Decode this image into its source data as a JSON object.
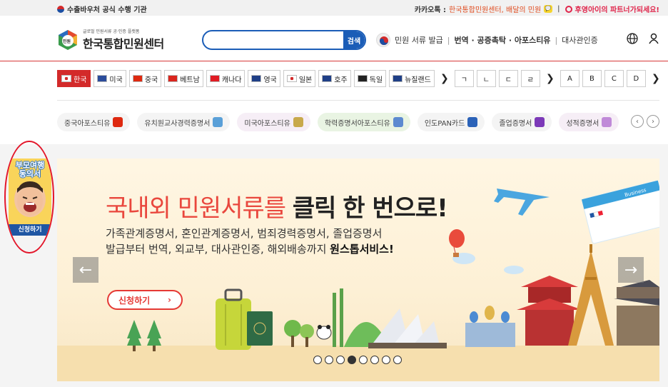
{
  "topbar": {
    "left_text": "수출바우처 공식 수행 기관",
    "kakao_label": "카카오톡 :",
    "kakao_text": "한국통합민원센터, 배달의 민원",
    "partner_text": "후영아이의 파트너가되세요!"
  },
  "header": {
    "logo_sub": "글로벌 민원서류 공·인증 플랫폼",
    "logo_main": "한국통합민원센터",
    "logo_badge": "민원",
    "search_placeholder": "",
    "search_button": "검색",
    "nav_issue": "민원 서류 발급",
    "nav_translation": "번역 · 공증촉탁 · 아포스티유",
    "nav_embassy": "대사관인증"
  },
  "flags": [
    {
      "label": "한국",
      "active": true,
      "color": "#ffffff"
    },
    {
      "label": "미국",
      "active": false,
      "color": "#2b4c9b"
    },
    {
      "label": "중국",
      "active": false,
      "color": "#de2910"
    },
    {
      "label": "베트남",
      "active": false,
      "color": "#da251d"
    },
    {
      "label": "캐나다",
      "active": false,
      "color": "#e01c24"
    },
    {
      "label": "영국",
      "active": false,
      "color": "#1f3f87"
    },
    {
      "label": "일본",
      "active": false,
      "color": "#ffffff"
    },
    {
      "label": "호주",
      "active": false,
      "color": "#1f3f87"
    },
    {
      "label": "독일",
      "active": false,
      "color": "#222222"
    },
    {
      "label": "뉴질랜드",
      "active": false,
      "color": "#1f3f87"
    }
  ],
  "letters": [
    "ㄱ",
    "ㄴ",
    "ㄷ",
    "ㄹ",
    "A",
    "B",
    "C",
    "D"
  ],
  "tags": [
    {
      "label": "중국아포스티유",
      "style": "",
      "icon_color": "#de2910"
    },
    {
      "label": "유치원교사경력증명서",
      "style": "",
      "icon_color": "#5aa0d8"
    },
    {
      "label": "미국아포스티유",
      "style": "pink",
      "icon_color": "#c8a94b"
    },
    {
      "label": "학력증명서아포스티유",
      "style": "green",
      "icon_color": "#5c8ad0"
    },
    {
      "label": "인도PAN카드",
      "style": "",
      "icon_color": "#2b62b8"
    },
    {
      "label": "졸업증명서",
      "style": "",
      "icon_color": "#7c3ab8"
    },
    {
      "label": "성적증명서",
      "style": "pink",
      "icon_color": "#c08ad8"
    }
  ],
  "side_banner": {
    "title_line1": "부모여행",
    "title_line2": "동의서",
    "button": "신청하기"
  },
  "hero": {
    "title_part1": "국내외 민원서류를",
    "title_part2": "클릭",
    "title_part3": "한 번으로!",
    "line1": "가족관계증명서, 혼인관계증명서, 범죄경력증명서, 졸업증명서",
    "line2": "발급부터 번역, 외교부, 대사관인증, 해외배송까지",
    "line2_bold": "원스톱서비스!",
    "apply": "신청하기",
    "apply_arrow": "›",
    "prev": "←",
    "next": "→",
    "dots": 8,
    "active_dot": 3,
    "plane_label": "Business"
  }
}
